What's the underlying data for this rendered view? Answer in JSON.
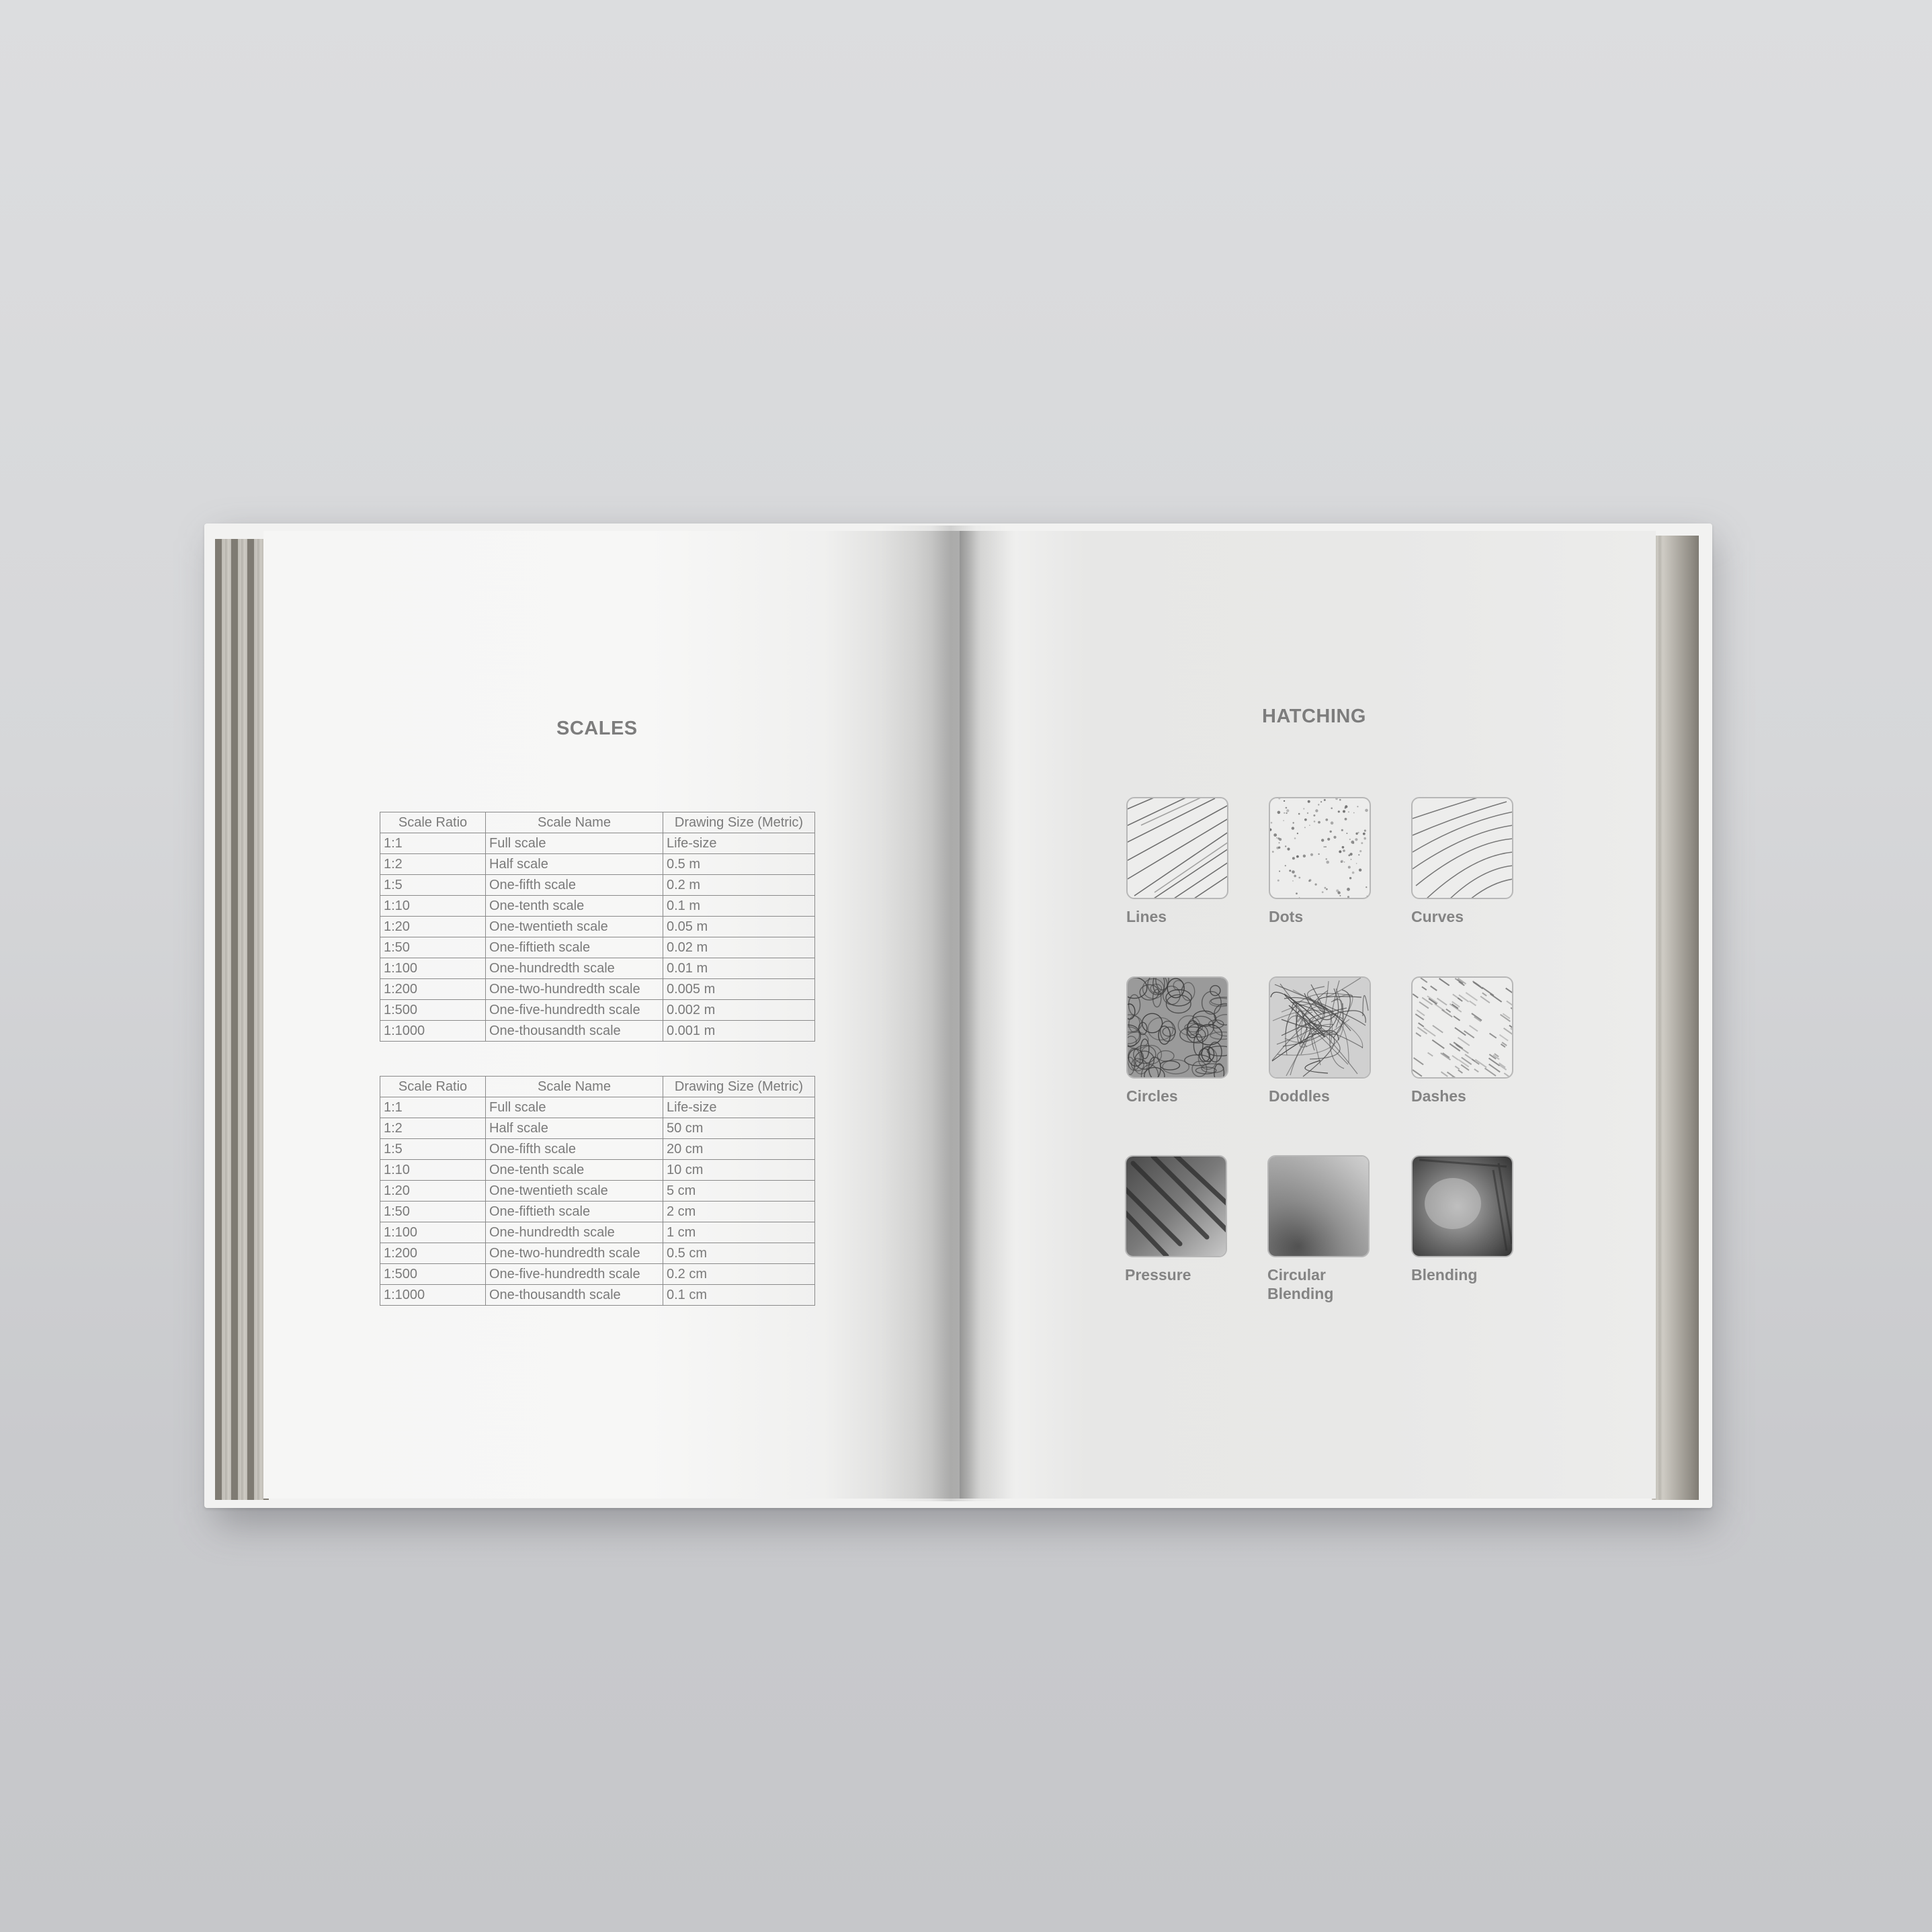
{
  "left_page": {
    "title": "SCALES",
    "tables": [
      {
        "headers": [
          "Scale Ratio",
          "Scale Name",
          "Drawing Size (Metric)"
        ],
        "rows": [
          [
            "1:1",
            "Full scale",
            "Life-size"
          ],
          [
            "1:2",
            "Half scale",
            "0.5 m"
          ],
          [
            "1:5",
            "One-fifth scale",
            "0.2 m"
          ],
          [
            "1:10",
            "One-tenth scale",
            "0.1 m"
          ],
          [
            "1:20",
            "One-twentieth scale",
            "0.05 m"
          ],
          [
            "1:50",
            "One-fiftieth scale",
            "0.02 m"
          ],
          [
            "1:100",
            "One-hundredth scale",
            "0.01 m"
          ],
          [
            "1:200",
            "One-two-hundredth scale",
            "0.005 m"
          ],
          [
            "1:500",
            "One-five-hundredth scale",
            "0.002 m"
          ],
          [
            "1:1000",
            "One-thousandth scale",
            "0.001 m"
          ]
        ]
      },
      {
        "headers": [
          "Scale Ratio",
          "Scale Name",
          "Drawing Size (Metric)"
        ],
        "rows": [
          [
            "1:1",
            "Full scale",
            "Life-size"
          ],
          [
            "1:2",
            "Half scale",
            "50 cm"
          ],
          [
            "1:5",
            "One-fifth scale",
            "20 cm"
          ],
          [
            "1:10",
            "One-tenth scale",
            "10 cm"
          ],
          [
            "1:20",
            "One-twentieth scale",
            "5 cm"
          ],
          [
            "1:50",
            "One-fiftieth scale",
            "2 cm"
          ],
          [
            "1:100",
            "One-hundredth scale",
            "1 cm"
          ],
          [
            "1:200",
            "One-two-hundredth scale",
            "0.5 cm"
          ],
          [
            "1:500",
            "One-five-hundredth scale",
            "0.2 cm"
          ],
          [
            "1:1000",
            "One-thousandth scale",
            "0.1 cm"
          ]
        ]
      }
    ]
  },
  "right_page": {
    "title": "HATCHING",
    "swatches": [
      {
        "label": "Lines",
        "icon": "lines-hatching-icon"
      },
      {
        "label": "Dots",
        "icon": "dots-hatching-icon"
      },
      {
        "label": "Curves",
        "icon": "curves-hatching-icon"
      },
      {
        "label": "Circles",
        "icon": "circles-hatching-icon"
      },
      {
        "label": "Doddles",
        "icon": "doddles-hatching-icon"
      },
      {
        "label": "Dashes",
        "icon": "dashes-hatching-icon"
      },
      {
        "label": "Pressure",
        "icon": "pressure-hatching-icon"
      },
      {
        "label": "Circular Blending",
        "icon": "circular-blending-icon"
      },
      {
        "label": "Blending",
        "icon": "blending-icon"
      }
    ]
  },
  "colors": {
    "background": "#d6d7d9",
    "page": "#f6f6f5",
    "text": "#7d7d7d",
    "table_border": "#8a8a8a"
  }
}
